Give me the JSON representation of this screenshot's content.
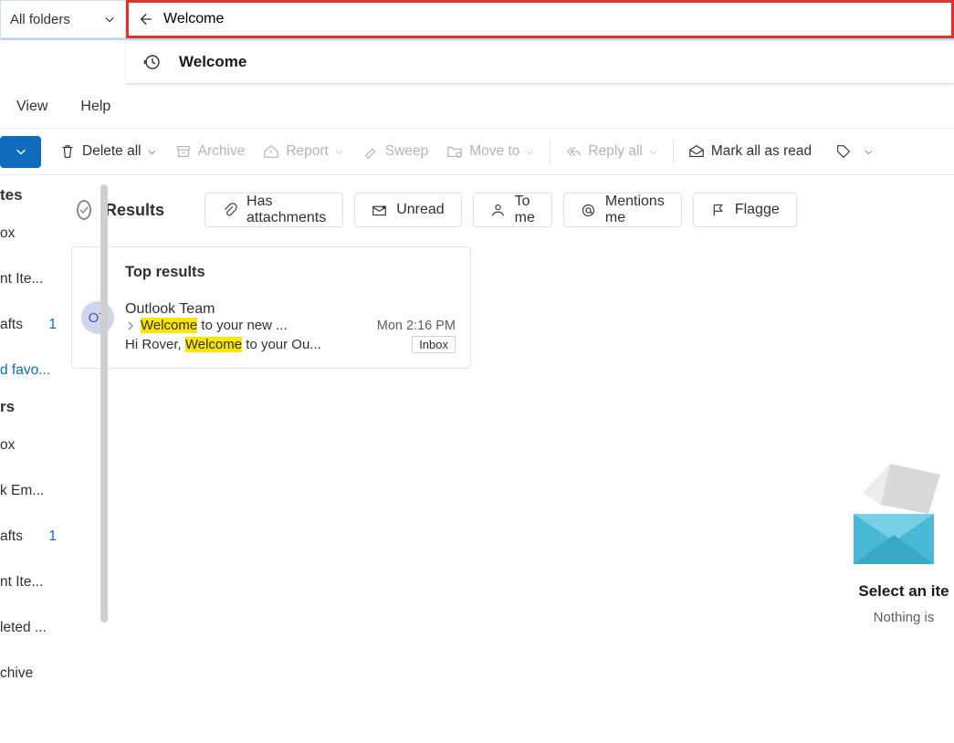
{
  "search": {
    "folder_scope": "All folders",
    "value": "Welcome",
    "suggestion": "Welcome"
  },
  "menu": {
    "view": "View",
    "help": "Help"
  },
  "toolbar": {
    "delete_all": "Delete all",
    "archive": "Archive",
    "report": "Report",
    "sweep": "Sweep",
    "move_to": "Move to",
    "reply_all": "Reply all",
    "mark_read": "Mark all as read"
  },
  "sidebar": {
    "section_fav": "tes",
    "fav_items": [
      "ox",
      "nt Ite...",
      "afts"
    ],
    "fav_draft_count": "1",
    "add_fav": "d favo...",
    "section_folders": "rs",
    "folders": [
      "ox",
      "k Em...",
      "afts",
      "nt Ite...",
      "leted ...",
      "chive"
    ],
    "folders_draft_count": "1"
  },
  "filters": {
    "results": "Results",
    "has_attachments": "Has attachments",
    "unread": "Unread",
    "to_me": "To me",
    "mentions_me": "Mentions me",
    "flagged": "Flagge"
  },
  "results": {
    "top_label": "Top results",
    "items": [
      {
        "avatar": "OT",
        "sender": "Outlook Team",
        "subject_pre_hl": "Welcome",
        "subject_post": " to your new ...",
        "time": "Mon 2:16 PM",
        "snippet_pre": "Hi Rover, ",
        "snippet_hl": "Welcome",
        "snippet_post": " to your Ou...",
        "folder": "Inbox"
      }
    ]
  },
  "right": {
    "select": "Select an ite",
    "nothing": "Nothing is"
  }
}
